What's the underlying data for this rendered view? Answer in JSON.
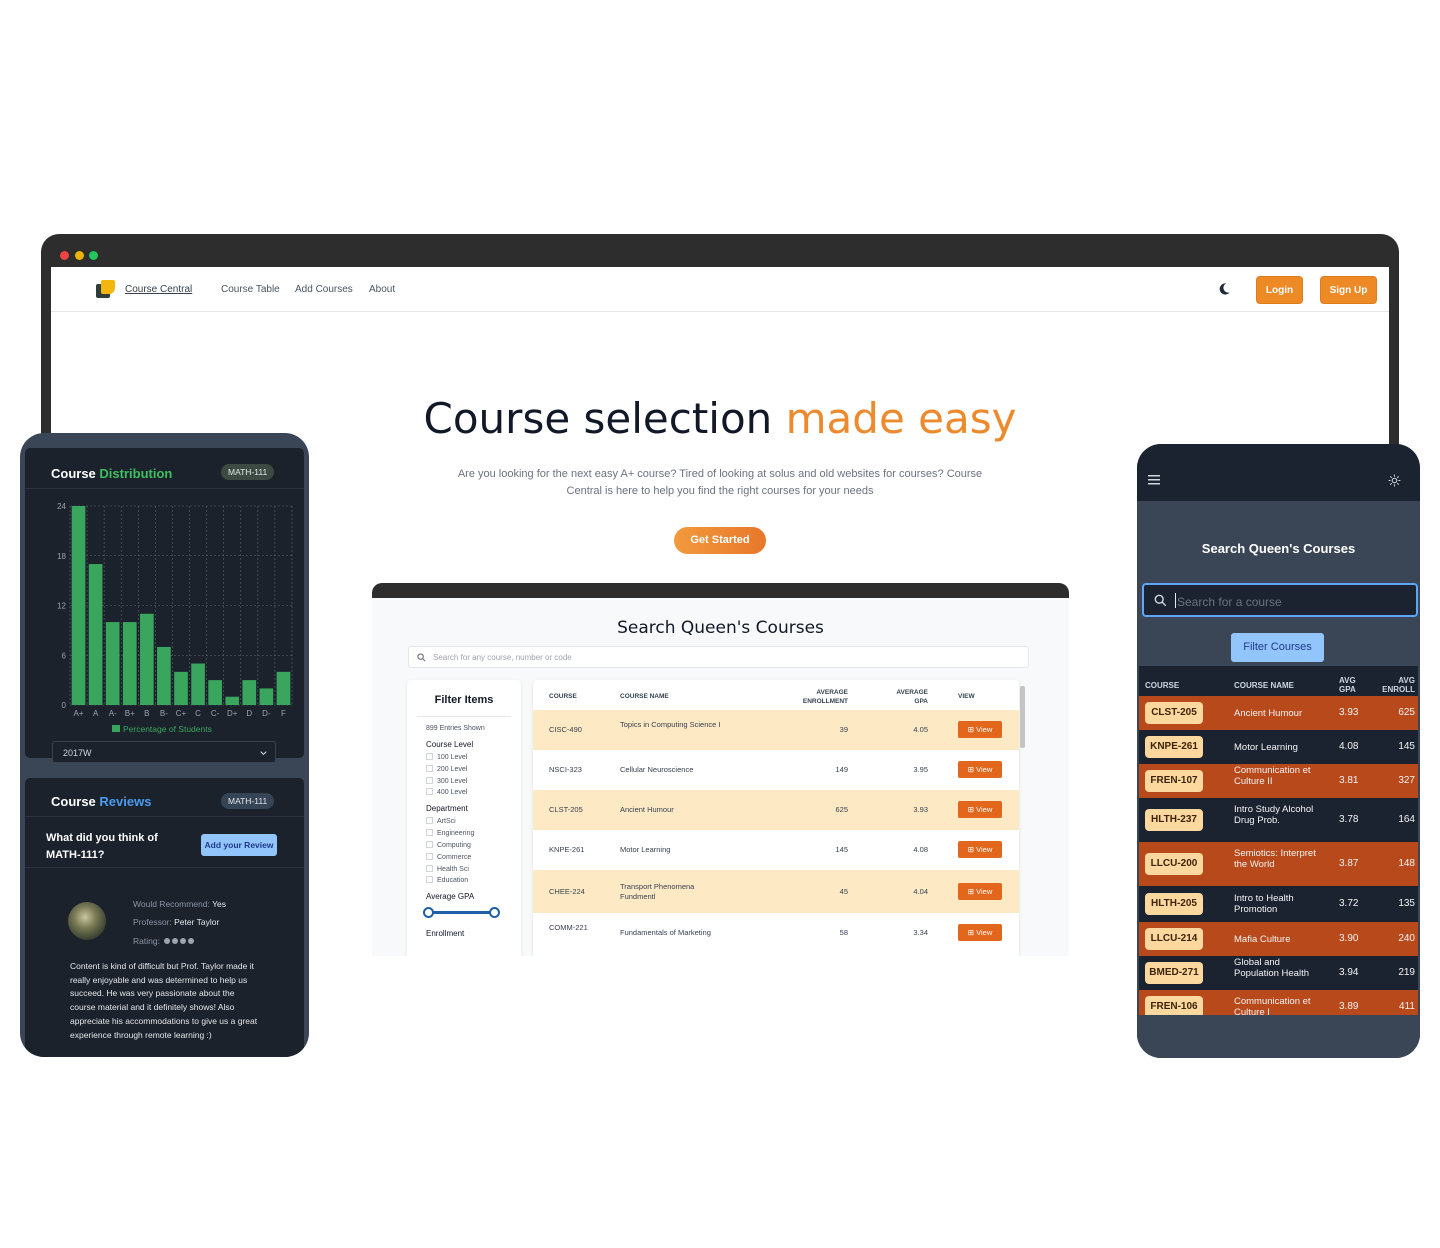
{
  "laptop": {
    "nav": {
      "brand": "Course Central",
      "links": [
        "Course Table",
        "Add Courses",
        "About"
      ],
      "login": "Login",
      "signup": "Sign Up"
    },
    "hero": {
      "title_main": "Course selection ",
      "title_highlight": "made easy",
      "subtitle": "Are you looking for the next easy A+ course? Tired of looking at solus and old websites for courses? Course Central is here to help you find the right courses for your needs",
      "cta": "Get Started"
    }
  },
  "tablet": {
    "title": "Search Queen's Courses",
    "search_placeholder": "Search for any course, number or code",
    "filter": {
      "title": "Filter Items",
      "entries": "899 Entries Shown",
      "course_level_label": "Course Level",
      "course_levels": [
        "100 Level",
        "200 Level",
        "300 Level",
        "400 Level"
      ],
      "department_label": "Department",
      "departments": [
        "ArtSci",
        "Engineering",
        "Computing",
        "Commerce",
        "Health Sci",
        "Education"
      ],
      "gpa_label": "Average GPA",
      "enrollment_label": "Enrollment"
    },
    "table": {
      "headers": {
        "course": "COURSE",
        "name": "COURSE NAME",
        "enroll_1": "AVERAGE",
        "enroll_2": "ENROLLMENT",
        "gpa_1": "AVERAGE",
        "gpa_2": "GPA",
        "view": "VIEW"
      },
      "view_label": "⊞ View",
      "rows": [
        {
          "code": "CISC-490",
          "name": "Topics in Computing Science I",
          "enrollment": "39",
          "gpa": "4.05"
        },
        {
          "code": "NSCI-323",
          "name": "Cellular Neuroscience",
          "enrollment": "149",
          "gpa": "3.95"
        },
        {
          "code": "CLST-205",
          "name": "Ancient Humour",
          "enrollment": "625",
          "gpa": "3.93"
        },
        {
          "code": "KNPE-261",
          "name": "Motor Learning",
          "enrollment": "145",
          "gpa": "4.08"
        },
        {
          "code": "CHEE-224",
          "name": "Transport Phenomena Fundmentl",
          "enrollment": "45",
          "gpa": "4.04"
        },
        {
          "code": "COMM-221",
          "name": "Fundamentals of Marketing",
          "enrollment": "58",
          "gpa": "3.34"
        }
      ]
    }
  },
  "left_phone": {
    "distribution": {
      "title_a": "Course ",
      "title_b": "Distribution",
      "badge": "MATH-111",
      "select_value": "2017W"
    },
    "reviews": {
      "title_a": "Course ",
      "title_b": "Reviews",
      "badge": "MATH-111",
      "question": "What did you think of MATH-111?",
      "add_button": "Add your Review",
      "recommend_label": "Would Recommend:",
      "recommend_value": "Yes",
      "professor_label": "Professor:",
      "professor_value": "Peter Taylor",
      "rating_label": "Rating:",
      "text": "Content is kind of difficult but Prof. Taylor made it really enjoyable and was determined to help us succeed. He was very passionate about the course material and it definitely shows! Also appreciate his accommodations to give us a great experience through remote learning :)"
    }
  },
  "chart_data": {
    "type": "bar",
    "categories": [
      "A+",
      "A",
      "A-",
      "B+",
      "B",
      "B-",
      "C+",
      "C",
      "C-",
      "D+",
      "D",
      "D-",
      "F"
    ],
    "series": [
      {
        "name": "Percentage of Students",
        "values": [
          24,
          17,
          10,
          10,
          11,
          7,
          4,
          5,
          3,
          1,
          3,
          2,
          4
        ]
      }
    ],
    "yticks": [
      0,
      6,
      12,
      18,
      24
    ],
    "ylim": [
      0,
      24
    ],
    "grid": true,
    "legend": "bottom",
    "color": "#3aa55d"
  },
  "right_phone": {
    "title": "Search Queen's Courses",
    "search_placeholder": "Search for a course",
    "filter_button": "Filter Courses",
    "headers": {
      "course": "COURSE",
      "name": "COURSE NAME",
      "gpa_1": "AVG",
      "gpa_2": "GPA",
      "enr_1": "AVG",
      "enr_2": "ENROLL"
    },
    "rows": [
      {
        "code": "CLST-205",
        "name": "Ancient Humour",
        "gpa": "3.93",
        "enroll": "625"
      },
      {
        "code": "KNPE-261",
        "name": "Motor Learning",
        "gpa": "4.08",
        "enroll": "145"
      },
      {
        "code": "FREN-107",
        "name": "Communication et Culture II",
        "gpa": "3.81",
        "enroll": "327"
      },
      {
        "code": "HLTH-237",
        "name": "Intro Study Alcohol Drug Prob.",
        "gpa": "3.78",
        "enroll": "164"
      },
      {
        "code": "LLCU-200",
        "name": "Semiotics: Interpret the World",
        "gpa": "3.87",
        "enroll": "148"
      },
      {
        "code": "HLTH-205",
        "name": "Intro to Health Promotion",
        "gpa": "3.72",
        "enroll": "135"
      },
      {
        "code": "LLCU-214",
        "name": "Mafia Culture",
        "gpa": "3.90",
        "enroll": "240"
      },
      {
        "code": "BMED-271",
        "name": "Global and Population Health",
        "gpa": "3.94",
        "enroll": "219"
      },
      {
        "code": "FREN-106",
        "name": "Communication et Culture I",
        "gpa": "3.89",
        "enroll": "411"
      }
    ]
  },
  "colors": {
    "accent_orange": "#ed8a26",
    "accent_green": "#3fbf5f",
    "accent_blue": "#4b9bf0",
    "row_odd_dark": "#b8491a",
    "row_even_dark": "#1c2330"
  }
}
